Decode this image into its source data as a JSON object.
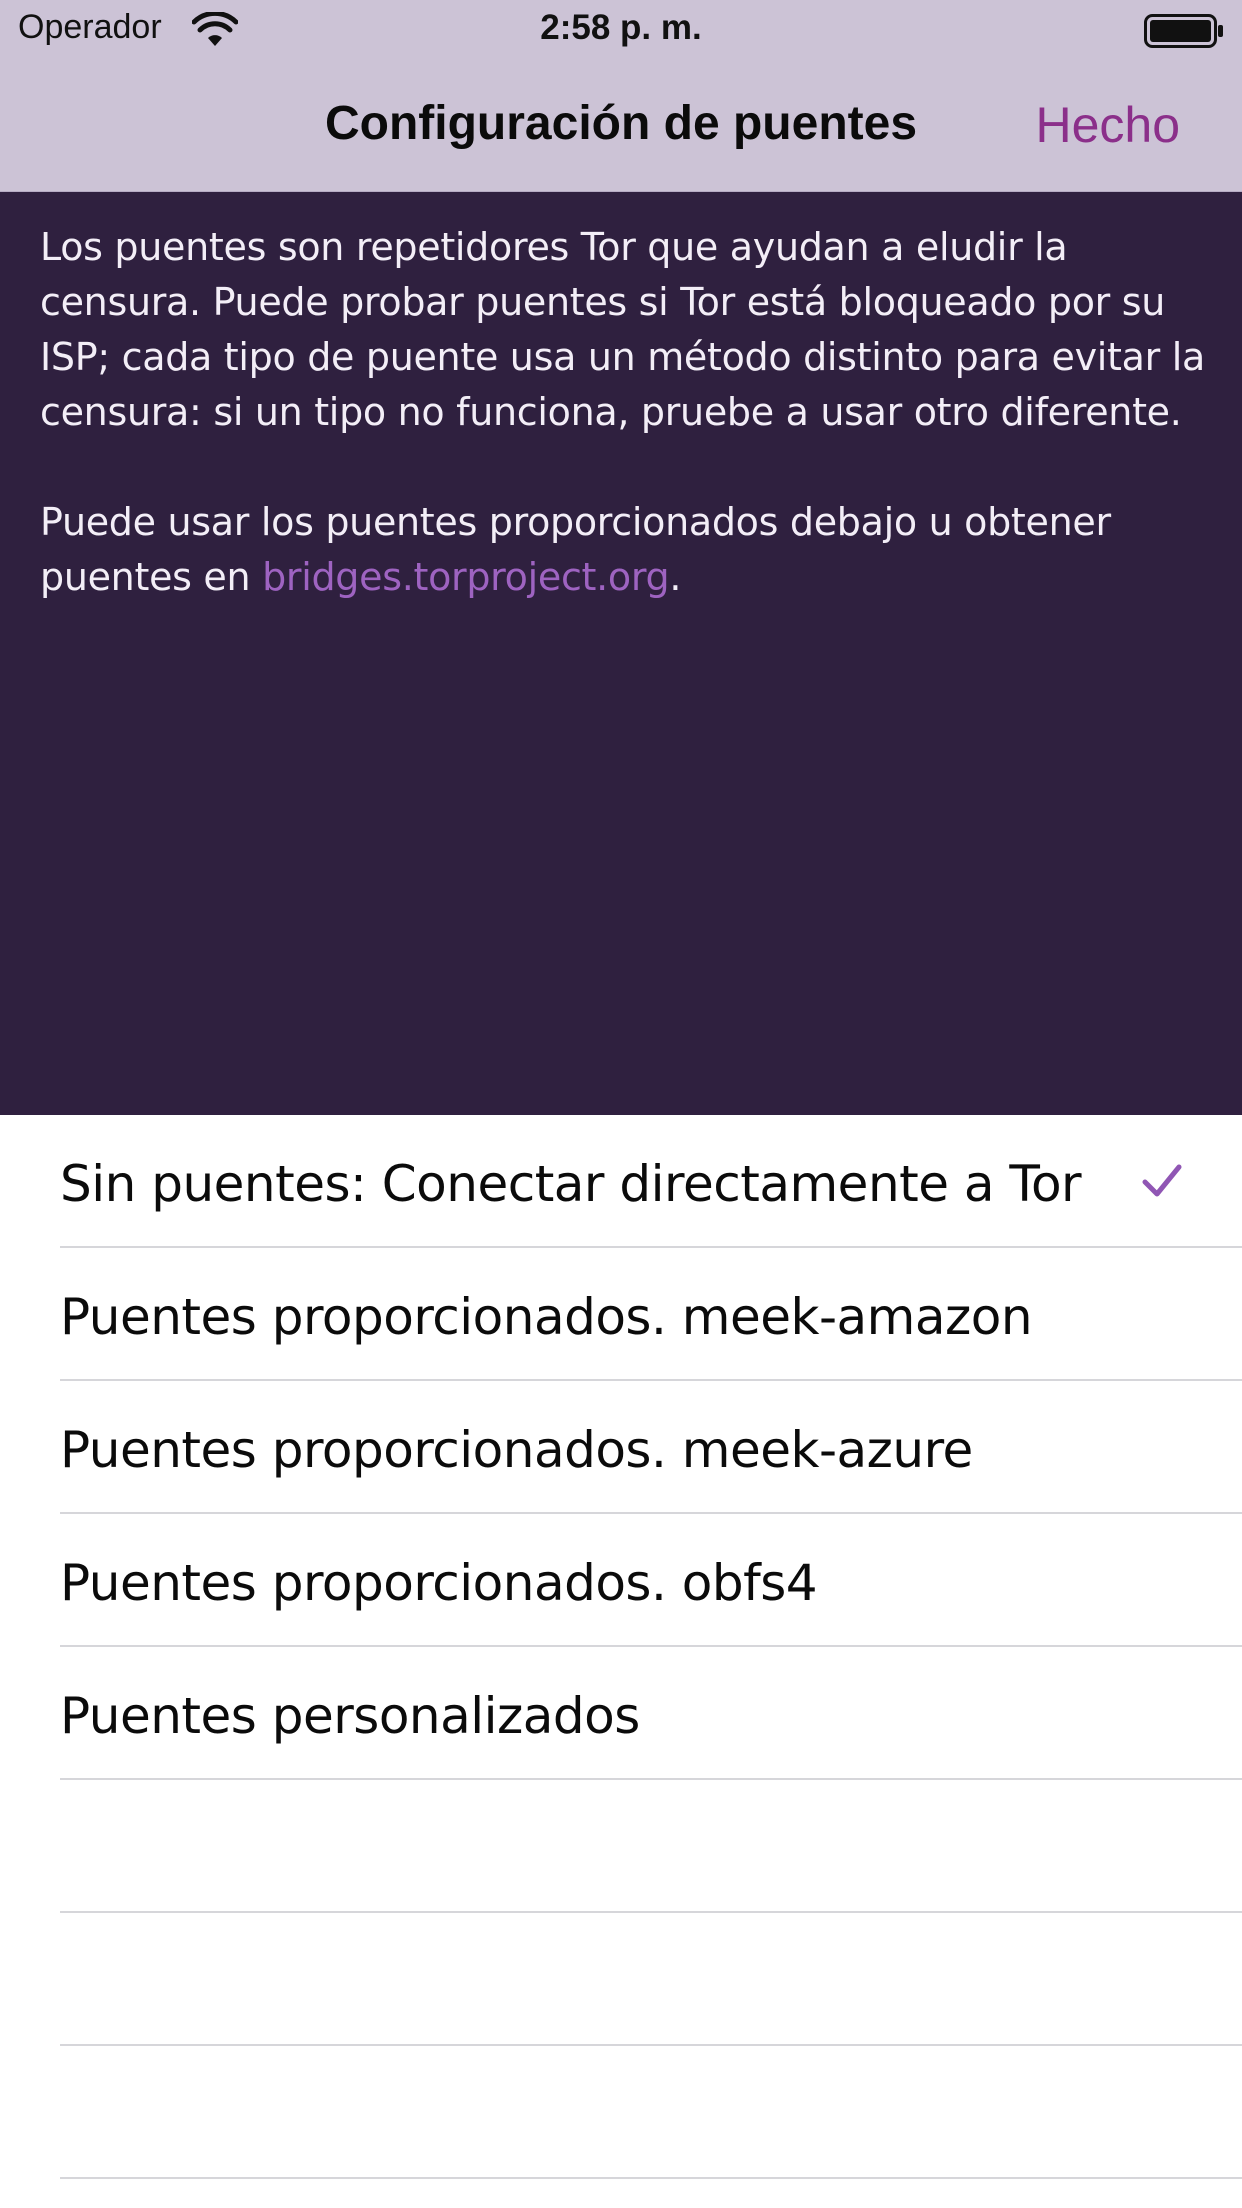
{
  "status_bar": {
    "carrier": "Operador",
    "time": "2:58 p. m.",
    "wifi_icon": "wifi-icon",
    "battery_icon": "battery-full-icon"
  },
  "nav": {
    "title": "Configuración de puentes",
    "done_label": "Hecho"
  },
  "intro": {
    "paragraph1": "Los puentes son repetidores Tor que ayudan a eludir la censura. Puede probar puentes si Tor está bloqueado por su ISP; cada tipo de puente usa un método distinto para evitar la censura: si un tipo no funciona, pruebe a usar otro diferente.",
    "paragraph2_prefix": "Puede usar los puentes proporcionados debajo u obtener puentes en ",
    "link_text": "bridges.torproject.org",
    "paragraph2_suffix": "."
  },
  "bridge_options": [
    {
      "label": "Sin puentes: Conectar directamente a Tor",
      "selected": true
    },
    {
      "label": "Puentes proporcionados. meek-amazon",
      "selected": false
    },
    {
      "label": "Puentes proporcionados. meek-azure",
      "selected": false
    },
    {
      "label": "Puentes proporcionados. obfs4",
      "selected": false
    },
    {
      "label": "Puentes personalizados",
      "selected": false
    }
  ],
  "colors": {
    "nav_background": "#ccc3d6",
    "intro_background": "#2f203f",
    "accent": "#8b2f8a",
    "link": "#9e63c1"
  }
}
